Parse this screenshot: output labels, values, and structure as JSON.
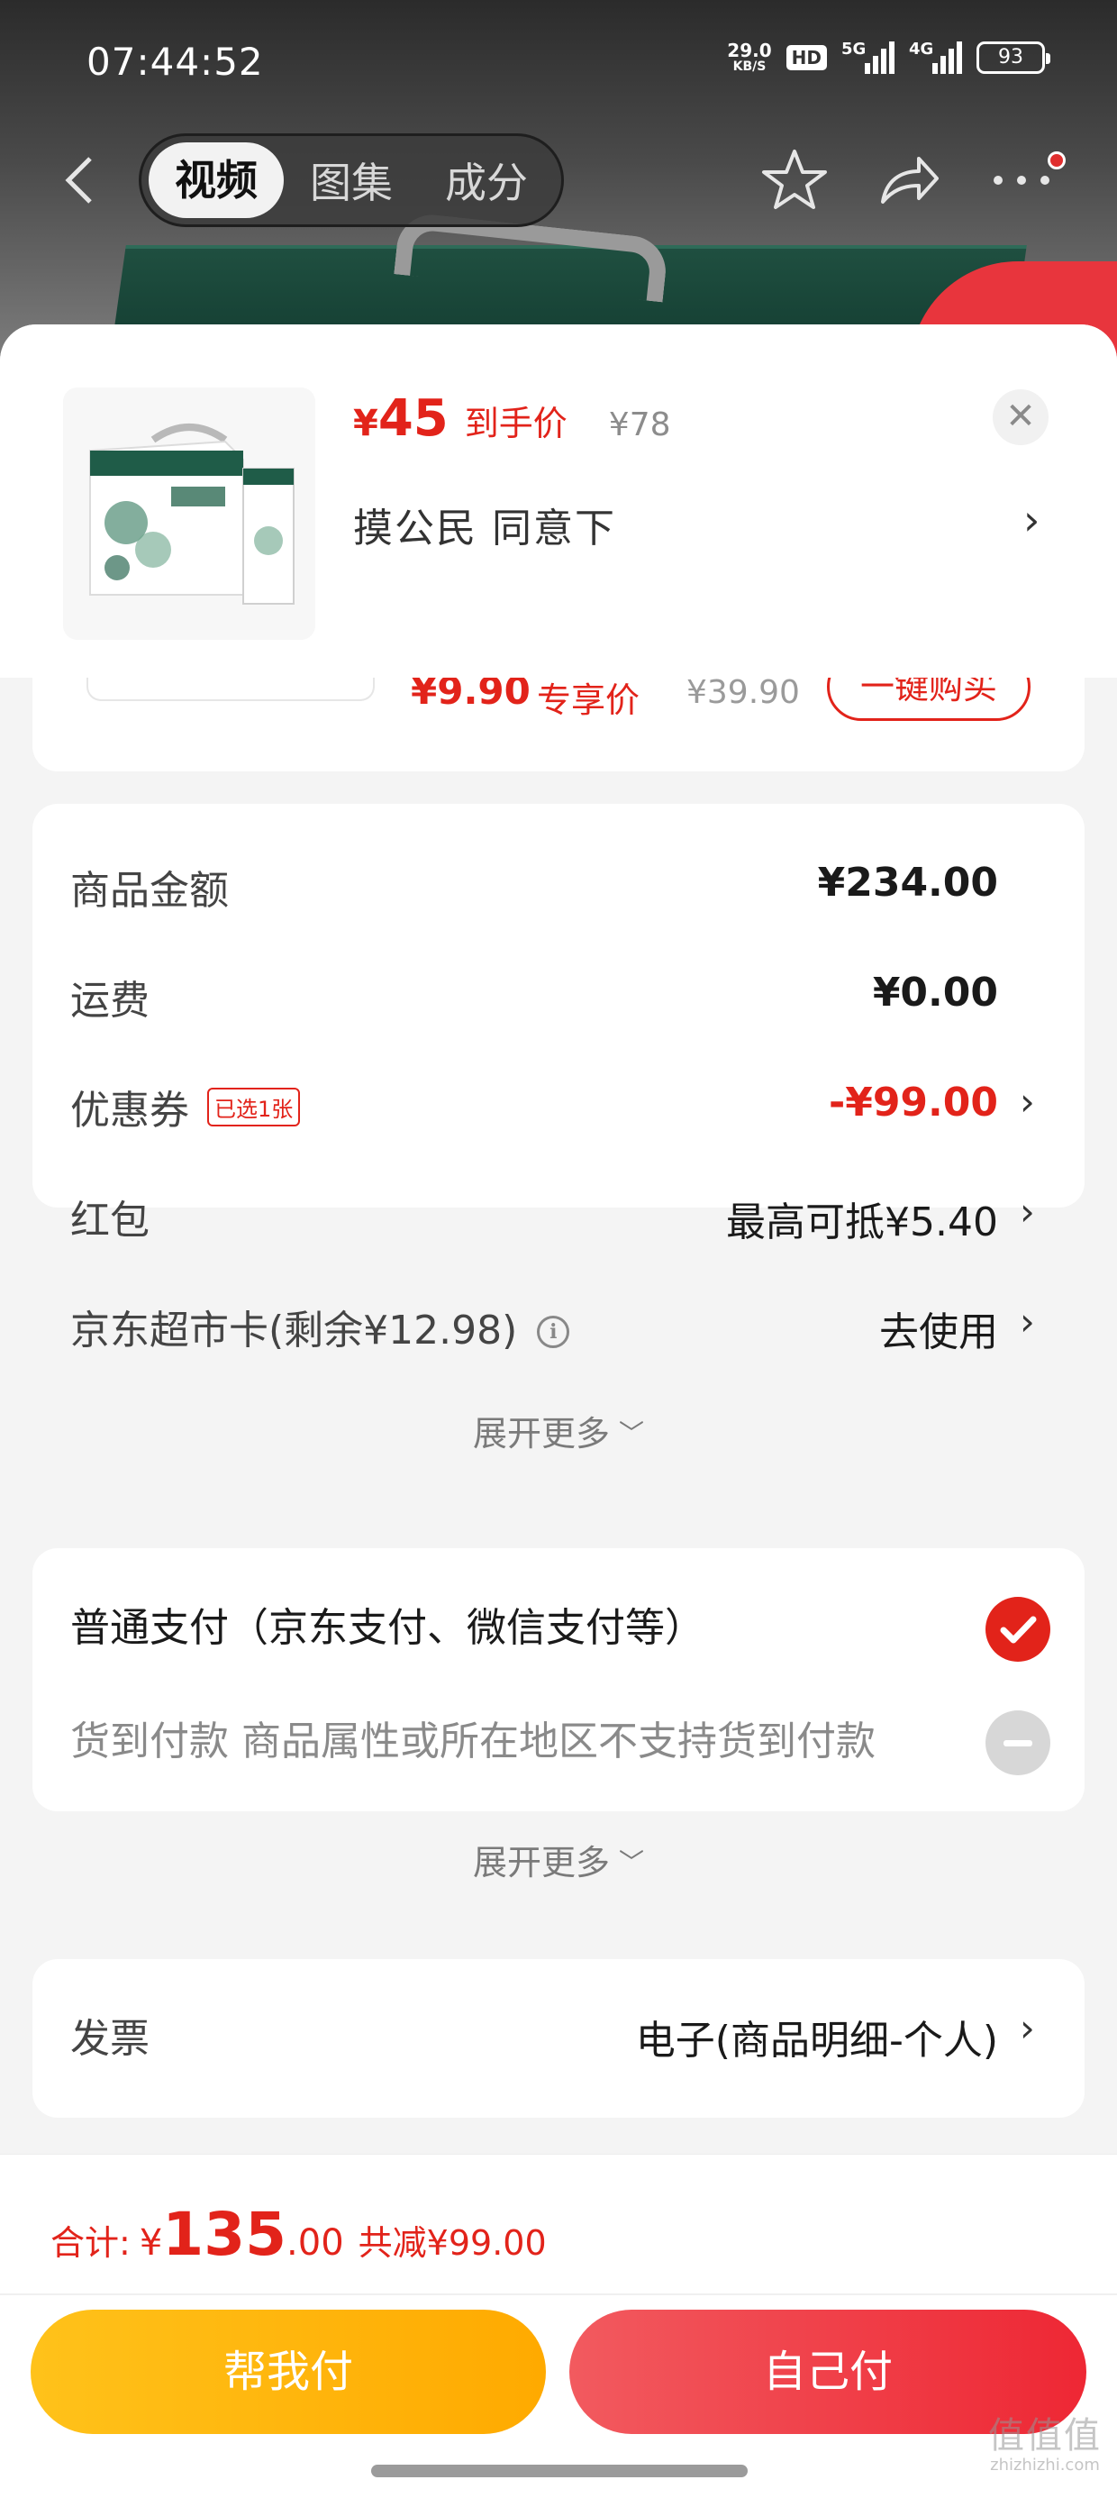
{
  "status_bar": {
    "time": "07:44:52",
    "net_speed": "29.0",
    "net_unit": "KB/S",
    "hd_label": "HD",
    "signal1_tag": "5G",
    "signal2_tag": "4G",
    "battery": "93"
  },
  "nav": {
    "tabs": [
      "视频",
      "图集",
      "成分"
    ],
    "active_tab": "视频"
  },
  "product": {
    "price_symbol": "¥",
    "price_value": "45",
    "price_tag": "到手价",
    "original_price": "¥78",
    "spec": "摸公民  同意下"
  },
  "peek_item": {
    "price": "¥9.90",
    "tag": "专享价",
    "original_price": "¥39.90",
    "button_label": "一键购买"
  },
  "fees": {
    "rows": [
      {
        "label": "商品金额",
        "value": "¥234.00"
      },
      {
        "label": "运费",
        "value": "¥0.00"
      },
      {
        "label": "优惠券",
        "badge": "已选1张",
        "value": "-¥99.00"
      },
      {
        "label": "红包",
        "value": "最高可抵¥5.40"
      },
      {
        "label": "京东超市卡(剩余¥12.98)",
        "value": "去使用"
      }
    ],
    "expand_label": "展开更多"
  },
  "payment": {
    "option1": "普通支付（京东支付、微信支付等）",
    "option2": "货到付款  商品属性或所在地区不支持货到付款",
    "expand_label": "展开更多"
  },
  "invoice": {
    "label": "发票",
    "value": "电子(商品明细-个人)"
  },
  "footer": {
    "total_label": "合计:",
    "total_symbol": "¥",
    "total_int": "135",
    "total_dec": ".00",
    "total_save": "共减¥99.00",
    "help_pay_label": "帮我付",
    "self_pay_label": "自己付"
  },
  "watermark": {
    "big": "值值值",
    "small": "zhizhizhi.com"
  },
  "colors": {
    "accent_red": "#e2231a",
    "help_button": "#ffb300",
    "self_button": "#ef2b36"
  },
  "icons": [
    "back-icon",
    "star-icon",
    "share-icon",
    "more-icon",
    "close-icon",
    "chevron-right-icon",
    "info-icon",
    "check-icon",
    "minus-icon"
  ]
}
